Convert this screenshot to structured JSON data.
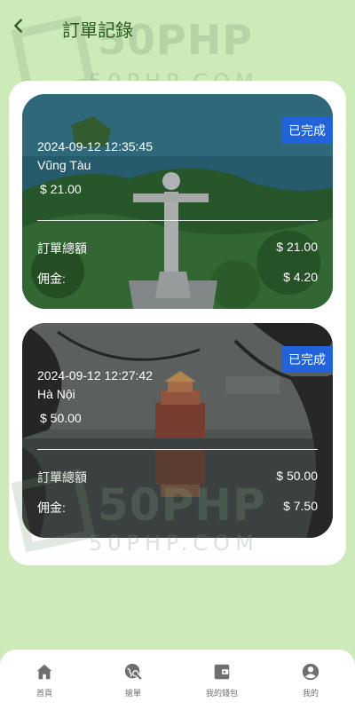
{
  "header": {
    "title": "訂單記錄"
  },
  "watermark": {
    "main": "50PHP",
    "sub": "50PHP.COM"
  },
  "orders": [
    {
      "status": "已完成",
      "time": "2024-09-12 12:35:45",
      "location": "Vũng Tàu",
      "price": "$ 21.00",
      "total_label": "訂單總額",
      "total_value": "$ 21.00",
      "commission_label": "佣金:",
      "commission_value": "$ 4.20"
    },
    {
      "status": "已完成",
      "time": "2024-09-12 12:27:42",
      "location": "Hà Nội",
      "price": "$ 50.00",
      "total_label": "訂單總額",
      "total_value": "$ 50.00",
      "commission_label": "佣金:",
      "commission_value": "$ 7.50"
    }
  ],
  "nav": {
    "items": [
      {
        "label": "首頁",
        "icon": "home-icon"
      },
      {
        "label": "搶單",
        "icon": "globe-search-icon"
      },
      {
        "label": "我的錢包",
        "icon": "wallet-icon"
      },
      {
        "label": "我的",
        "icon": "user-icon"
      }
    ]
  },
  "colors": {
    "background": "#cdebb8",
    "title": "#2d5a1e",
    "badge": "#2363d9",
    "nav_icon": "#6f6f6f"
  }
}
